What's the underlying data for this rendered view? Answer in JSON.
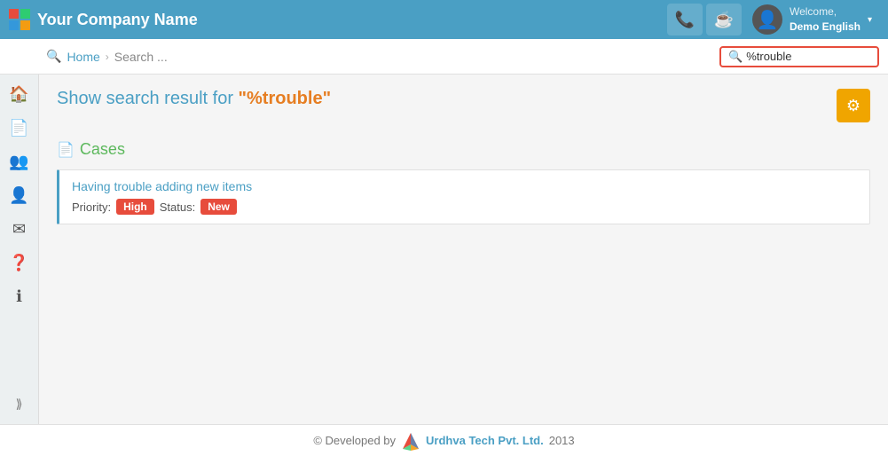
{
  "topbar": {
    "company_name": "Your Company Name",
    "phone_icon": "📞",
    "chat_icon": "☕",
    "welcome_text": "Welcome,",
    "user_name": "Demo English"
  },
  "breadcrumb": {
    "home_label": "Home",
    "separator": "›",
    "current_label": "Search ...",
    "search_placeholder": "%trouble",
    "search_value": "%trouble"
  },
  "page": {
    "title_prefix": "Show search result for ",
    "search_term": "\"%trouble\"",
    "settings_icon": "⚙"
  },
  "cases_section": {
    "title": "Cases",
    "case": {
      "title": "Having trouble adding new items",
      "priority_label": "Priority:",
      "priority_value": "High",
      "status_label": "Status:",
      "status_value": "New"
    }
  },
  "footer": {
    "copyright": "© Developed by",
    "company_name": "Urdhva Tech Pvt. Ltd.",
    "year": "2013"
  },
  "sidebar": {
    "items": [
      {
        "icon": "🏠",
        "name": "home"
      },
      {
        "icon": "📄",
        "name": "documents"
      },
      {
        "icon": "👥",
        "name": "contacts"
      },
      {
        "icon": "👤",
        "name": "users"
      },
      {
        "icon": "✉",
        "name": "mail"
      },
      {
        "icon": "❓",
        "name": "help"
      },
      {
        "icon": "ℹ",
        "name": "info"
      }
    ],
    "expand_icon": "⟫"
  }
}
